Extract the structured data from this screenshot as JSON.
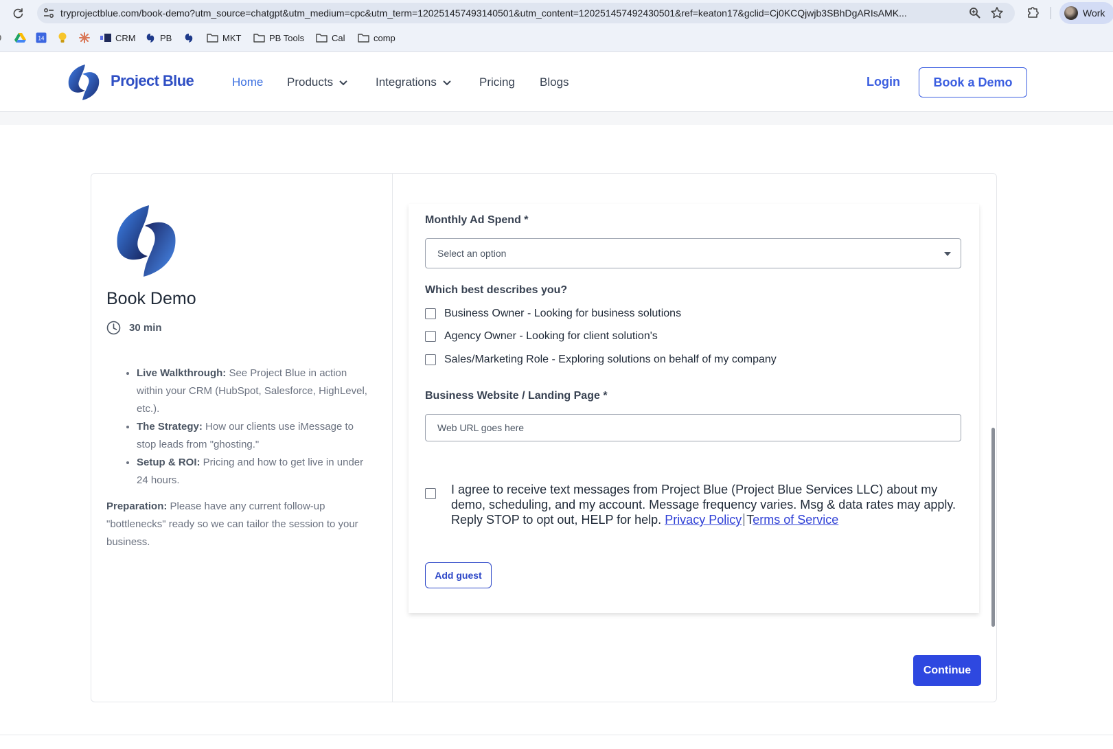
{
  "browser": {
    "url": "tryprojectblue.com/book-demo?utm_source=chatgpt&utm_medium=cpc&utm_term=120251457493140501&utm_content=120251457492430501&ref=keaton17&gclid=Cj0KCQjwjb3SBhDgARIsAMK...",
    "profile_label": "Work",
    "bookmarks": [
      {
        "label": "",
        "icon": "google-drive-icon"
      },
      {
        "label": "",
        "icon": "calendar-icon"
      },
      {
        "label": "",
        "icon": "lightbulb-icon"
      },
      {
        "label": "",
        "icon": "claude-icon"
      },
      {
        "label": "CRM",
        "icon": "crm-icon"
      },
      {
        "label": "PB",
        "icon": "project-blue-icon"
      },
      {
        "label": "",
        "icon": "project-blue-icon"
      },
      {
        "label": "MKT",
        "icon": "folder-icon"
      },
      {
        "label": "PB Tools",
        "icon": "folder-icon"
      },
      {
        "label": "Cal",
        "icon": "folder-icon"
      },
      {
        "label": "comp",
        "icon": "folder-icon"
      }
    ],
    "calendar_day": "14"
  },
  "header": {
    "brand": "Project Blue",
    "nav": [
      {
        "label": "Home",
        "active": true
      },
      {
        "label": "Products",
        "dropdown": true
      },
      {
        "label": "Integrations",
        "dropdown": true
      },
      {
        "label": "Pricing"
      },
      {
        "label": "Blogs"
      }
    ],
    "login_label": "Login",
    "cta_label": "Book a Demo"
  },
  "event": {
    "title": "Book Demo",
    "duration": "30 min",
    "bullets": [
      {
        "bold": "Live Walkthrough:",
        "text": " See Project Blue in action within your CRM (HubSpot, Salesforce, HighLevel, etc.)."
      },
      {
        "bold": "The Strategy:",
        "text": " How our clients use iMessage to stop leads from \"ghosting.\""
      },
      {
        "bold": "Setup & ROI:",
        "text": " Pricing and how to get live in under 24 hours."
      }
    ],
    "prep_bold": "Preparation:",
    "prep_text": " Please have any current follow-up \"bottlenecks\" ready so we can tailor the session to your business."
  },
  "form": {
    "ad_spend_label": "Monthly Ad Spend *",
    "ad_spend_value": "Select an option",
    "describes_label": "Which best describes you?",
    "describes_options": [
      "Business Owner - Looking for business solutions",
      "Agency Owner - Looking for client solution's",
      "Sales/Marketing Role - Exploring solutions on behalf of my company"
    ],
    "website_label": "Business Website / Landing Page *",
    "website_placeholder": "Web URL goes here",
    "consent_text": "I agree to receive text messages from Project Blue (Project Blue Services LLC) about my demo, scheduling, and my account. Message frequency varies. Msg & data rates may apply. Reply STOP to opt out, HELP for help. ",
    "privacy_link": "Privacy Policy",
    "terms_prefix": "T",
    "terms_link": "erms of Service",
    "add_guest_label": "Add guest",
    "continue_label": "Continue"
  },
  "colors": {
    "brand_blue": "#3b5ee0",
    "continue_bg": "#2e48e0",
    "nav_active": "#3b6fe0"
  }
}
